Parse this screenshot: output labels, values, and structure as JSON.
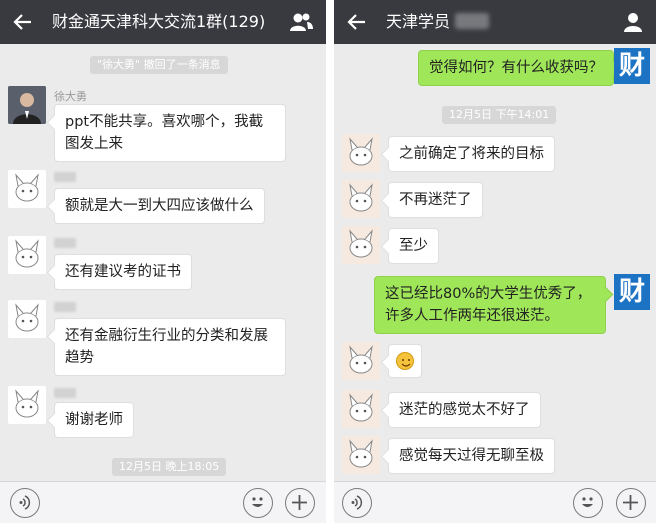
{
  "left": {
    "title": "财金通天津科大交流1群(129)",
    "system_notice": "\"徐大勇\" 撤回了一条消息",
    "sender_name": "徐大勇",
    "messages": [
      "ppt不能共享。喜欢哪个，我截图发上来",
      "额就是大一到大四应该做什么",
      "还有建议考的证书",
      "还有金融衍生行业的分类和发展趋势",
      "谢谢老师"
    ],
    "timestamp": "12月5日 晚上18:05"
  },
  "right": {
    "title": "天津学员",
    "messages": {
      "m0": "觉得如何？有什么收获吗？",
      "m1": "之前确定了将来的目标",
      "m2": "不再迷茫了",
      "m3": "至少",
      "m4": "这已经比80%的大学生优秀了，许多人工作两年还很迷茫。",
      "m6": "迷茫的感觉太不好了",
      "m7": "感觉每天过得无聊至极"
    },
    "timestamp": "12月5日 下午14:01",
    "brand_avatar": "财"
  },
  "icons": {
    "back": "back-arrow-icon",
    "group": "group-icon",
    "profile": "person-icon",
    "voice": "voice-icon",
    "emoji": "emoji-icon",
    "plus": "plus-icon"
  },
  "colors": {
    "titlebar": "#393a3f",
    "background": "#ebebeb",
    "outgoing_bubble": "#9fe658",
    "brand_blue": "#1c73c4"
  }
}
